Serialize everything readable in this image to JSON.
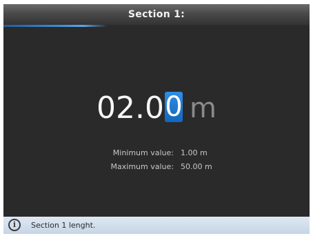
{
  "header": {
    "title": "Section 1:"
  },
  "editor": {
    "value_prefix": "02.0",
    "cursor_digit": "0",
    "unit": "m"
  },
  "limits": {
    "minimum_label": "Minimum value:",
    "minimum_value": "1.00 m",
    "maximum_label": "Maximum value:",
    "maximum_value": "50.00 m"
  },
  "status": {
    "icon": "info-icon",
    "text": "Section 1 lenght."
  },
  "colors": {
    "accent": "#1a73d0",
    "background": "#2a2a2a",
    "status_bar": "#d3dfeb"
  }
}
